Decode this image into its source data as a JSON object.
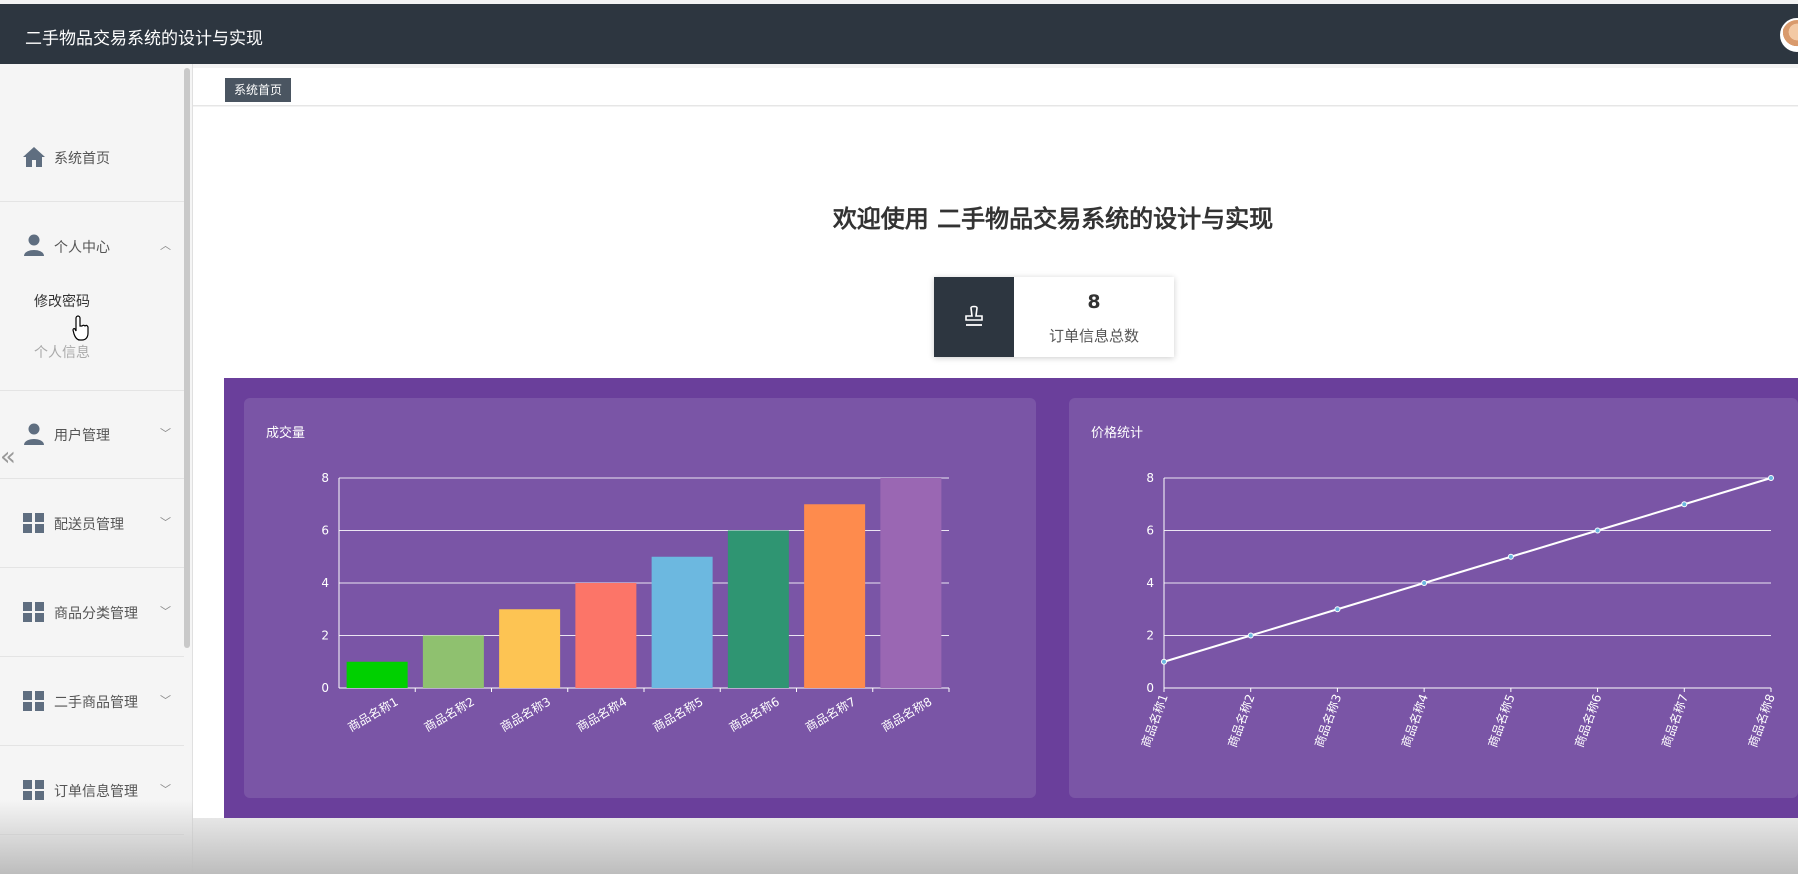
{
  "header": {
    "title": "二手物品交易系统的设计与实现"
  },
  "sidebar": {
    "items": [
      {
        "label": "系统首页",
        "icon": "home-icon"
      },
      {
        "label": "个人中心",
        "icon": "user-icon",
        "expanded": true,
        "children": [
          "修改密码",
          "个人信息"
        ]
      },
      {
        "label": "用户管理",
        "icon": "user-icon"
      },
      {
        "label": "配送员管理",
        "icon": "grid-icon"
      },
      {
        "label": "商品分类管理",
        "icon": "grid-icon"
      },
      {
        "label": "二手商品管理",
        "icon": "grid-icon"
      },
      {
        "label": "订单信息管理",
        "icon": "grid-icon"
      }
    ]
  },
  "breadcrumb": {
    "label": "系统首页"
  },
  "main": {
    "welcome": "欢迎使用 二手物品交易系统的设计与实现",
    "stat": {
      "value": "8",
      "label": "订单信息总数",
      "icon": "stamp-icon"
    }
  },
  "colors": {
    "header": "#2d3640",
    "chart_bg": "#6a3f9b",
    "panel_bg": "#7a55a6"
  },
  "chart_data": [
    {
      "type": "bar",
      "title": "成交量",
      "categories": [
        "商品名称1",
        "商品名称2",
        "商品名称3",
        "商品名称4",
        "商品名称5",
        "商品名称6",
        "商品名称7",
        "商品名称8"
      ],
      "values": [
        1,
        2,
        3,
        4,
        5,
        6,
        7,
        8
      ],
      "colors": [
        "#00d000",
        "#8fc16f",
        "#fdc453",
        "#fc7568",
        "#6cb8e0",
        "#2f9572",
        "#fe8b4d",
        "#9a67b3"
      ],
      "ylim": [
        0,
        8
      ],
      "yticks": [
        0,
        2,
        4,
        6,
        8
      ],
      "grid": true
    },
    {
      "type": "line",
      "title": "价格统计",
      "categories": [
        "商品名称1",
        "商品名称2",
        "商品名称3",
        "商品名称4",
        "商品名称5",
        "商品名称6",
        "商品名称7",
        "商品名称8"
      ],
      "values": [
        1,
        2,
        3,
        4,
        5,
        6,
        7,
        8
      ],
      "ylim": [
        0,
        8
      ],
      "yticks": [
        0,
        2,
        4,
        6,
        8
      ],
      "grid": true
    }
  ]
}
